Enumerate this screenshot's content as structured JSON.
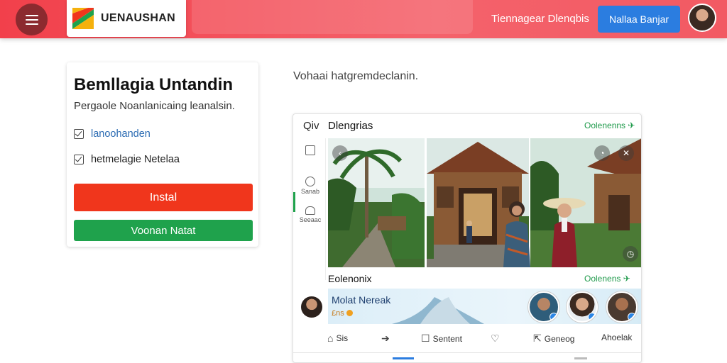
{
  "header": {
    "brand_name": "UENAUSHAN",
    "nav_link": "Tiennagear Dlenqbis",
    "cta_button": "Nallaa Banjar",
    "colors": {
      "bar": "#f2404b",
      "cta": "#2b7de0"
    }
  },
  "left_card": {
    "title": "Bemllagia Untandin",
    "subtitle": "Pergaole Noanlanicaing leanalsin.",
    "checks": [
      {
        "label": "lanoohanden",
        "checked": true
      },
      {
        "label": "hetmelagie Netelaa",
        "checked": true
      }
    ],
    "install_button": "Instal",
    "secondary_button": "Voonan Natat",
    "colors": {
      "install": "#f0361c",
      "secondary": "#1fa24c"
    }
  },
  "main_heading": "Vohaai hatgremdeclanin.",
  "feed_card": {
    "q_label": "Qiv",
    "title": "Dlengrias",
    "top_link": "Oolenenns",
    "side_nav": [
      {
        "icon": "document-icon",
        "label": ""
      },
      {
        "icon": "circle-icon",
        "label": "Sanab"
      },
      {
        "icon": "shape-icon",
        "label": "Seeaac"
      }
    ],
    "section_title": "Eolenonix",
    "section_link": "Oolenens",
    "story": {
      "title": "Molat Nereak",
      "meta": "£ns"
    },
    "actions": [
      {
        "icon": "home-icon",
        "label": "Sis"
      },
      {
        "icon": "arrow-icon",
        "label": ""
      },
      {
        "icon": "comment-icon",
        "label": "Sentent"
      },
      {
        "icon": "heart-icon",
        "label": ""
      },
      {
        "icon": "send-icon",
        "label": "Geneog"
      },
      {
        "icon": "more-icon",
        "label": "Ahoelak"
      }
    ]
  }
}
